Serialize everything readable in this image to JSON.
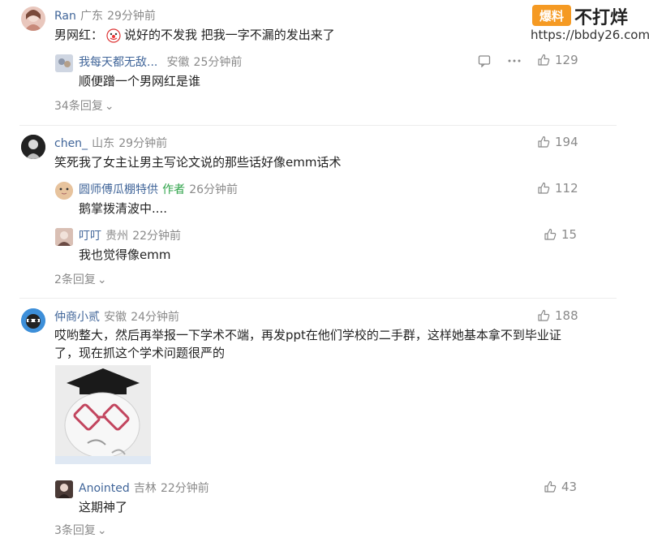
{
  "watermark": {
    "logo": "爆料",
    "name": "不打烊",
    "url": "https://bbdy26.com"
  },
  "comments": [
    {
      "author": "Ran",
      "location": "广东",
      "time": "29分钟前",
      "text": "男网红：",
      "text_after_emoji": "说好的不发我 把我一字不漏的发出来了",
      "reply": {
        "author": "我每天都无敌...",
        "location": "安徽",
        "time": "25分钟前",
        "text": "顺便蹭一个男网红是谁",
        "likes": "129"
      },
      "reply_count": "34条回复"
    },
    {
      "author": "chen_",
      "location": "山东",
      "time": "29分钟前",
      "text": "笑死我了女主让男主写论文说的那些话好像emm话术",
      "likes": "194",
      "replies": [
        {
          "author": "圆师傅瓜棚特供",
          "tag": "作者",
          "time": "26分钟前",
          "text": "鹅掌拨清波中....",
          "likes": "112"
        },
        {
          "author": "叮叮",
          "location": "贵州",
          "time": "22分钟前",
          "text": "我也觉得像emm",
          "likes": "15"
        }
      ],
      "reply_count": "2条回复"
    },
    {
      "author": "仲商小贰",
      "location": "安徽",
      "time": "24分钟前",
      "text": "哎哟整大，然后再举报一下学术不端，再发ppt在他们学校的二手群，这样她基本拿不到毕业证了，现在抓这个学术问题很严的",
      "likes": "188",
      "reply": {
        "author": "Anointed",
        "location": "吉林",
        "time": "22分钟前",
        "text": "这期神了",
        "likes": "43"
      },
      "reply_count": "3条回复"
    }
  ],
  "icons": {
    "like": "thumbs-up-icon",
    "comment": "comment-icon",
    "more": "more-dots-icon",
    "chevron": "chevron-down-icon"
  }
}
